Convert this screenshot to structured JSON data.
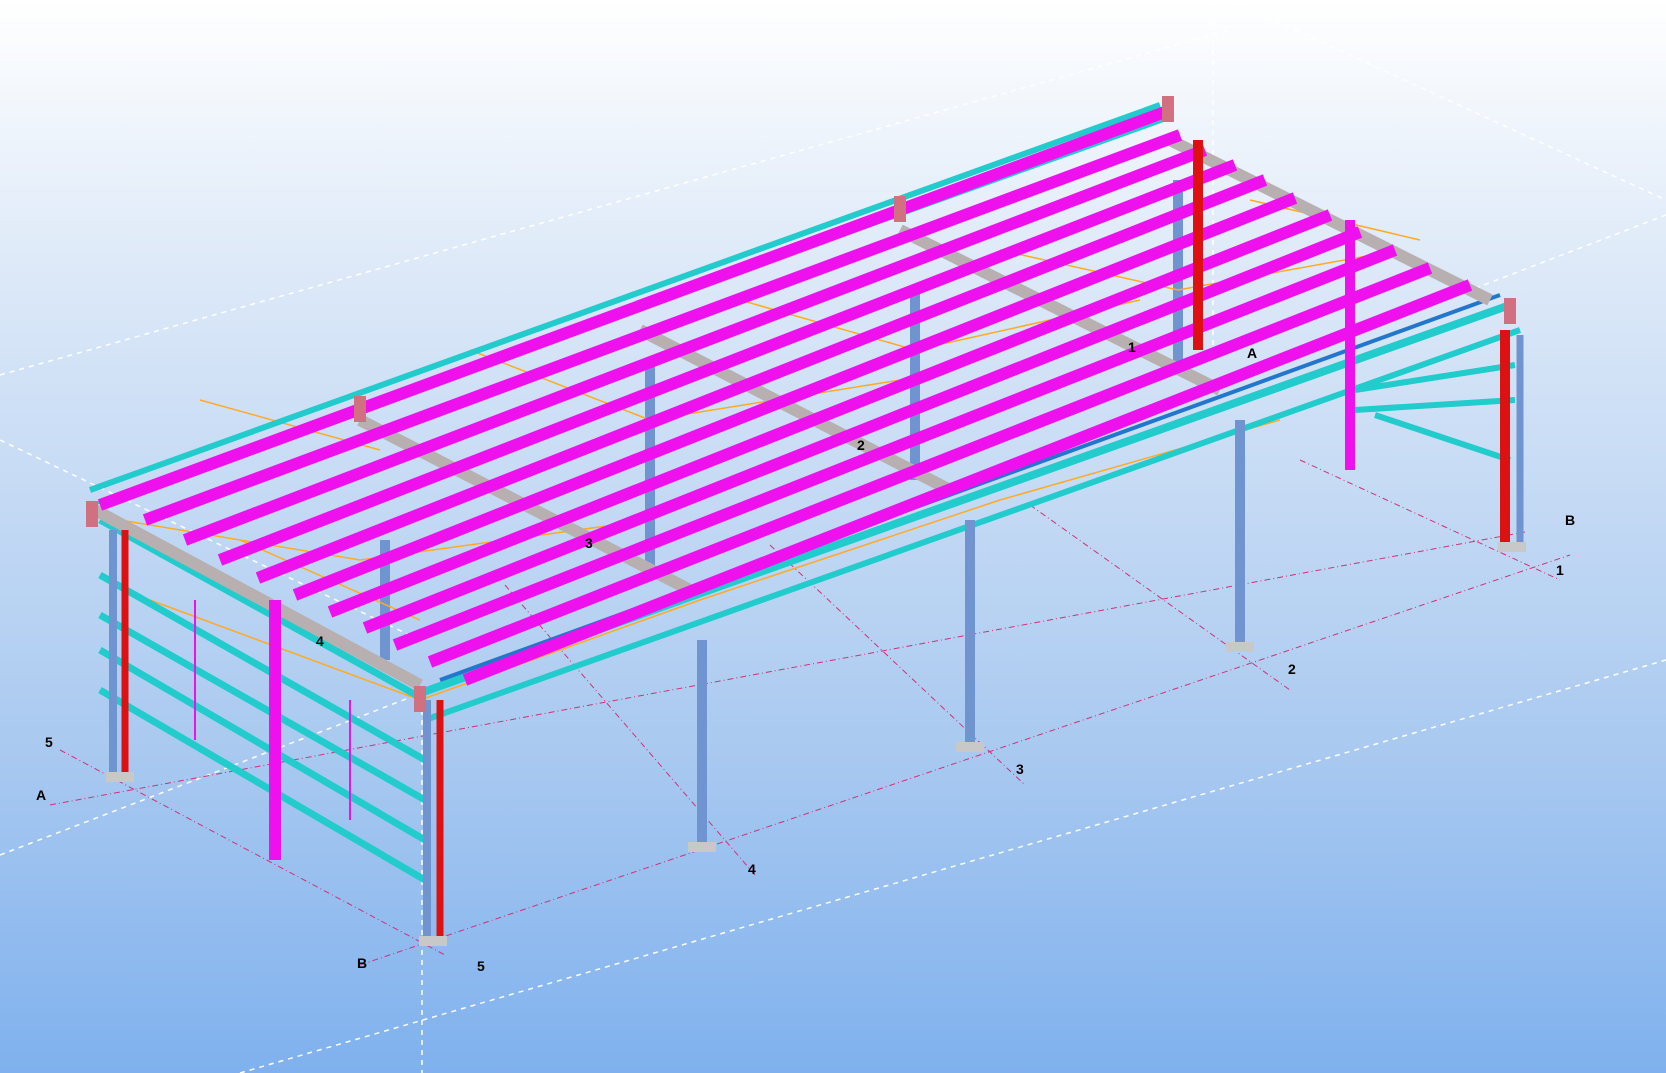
{
  "app": {
    "view": "3D model view"
  },
  "grid": {
    "number_labels": [
      "1",
      "2",
      "3",
      "4",
      "5"
    ],
    "letter_labels": [
      "A",
      "B"
    ]
  },
  "colors": {
    "purlin": "#ee11ee",
    "rail": "#22cccc",
    "column": "#7094d0",
    "column_red": "#dd1111",
    "rafter": "#b8b0b0",
    "bracing": "#ffaa22",
    "grid_line": "#cc3377"
  },
  "labels": [
    {
      "text": "B",
      "name": "grid-label-b-right"
    },
    {
      "text": "1",
      "name": "grid-label-1-right"
    },
    {
      "text": "2",
      "name": "grid-label-2-front"
    },
    {
      "text": "3",
      "name": "grid-label-3-front"
    },
    {
      "text": "4",
      "name": "grid-label-4-front"
    },
    {
      "text": "5",
      "name": "grid-label-5-front"
    },
    {
      "text": "B",
      "name": "grid-label-b-front"
    },
    {
      "text": "A",
      "name": "grid-label-a-left"
    },
    {
      "text": "5",
      "name": "grid-label-5-left"
    },
    {
      "text": "4",
      "name": "grid-label-4-roof"
    },
    {
      "text": "3",
      "name": "grid-label-3-roof"
    },
    {
      "text": "2",
      "name": "grid-label-2-roof"
    },
    {
      "text": "1",
      "name": "grid-label-1-roof"
    },
    {
      "text": "A",
      "name": "grid-label-a-roof"
    }
  ]
}
